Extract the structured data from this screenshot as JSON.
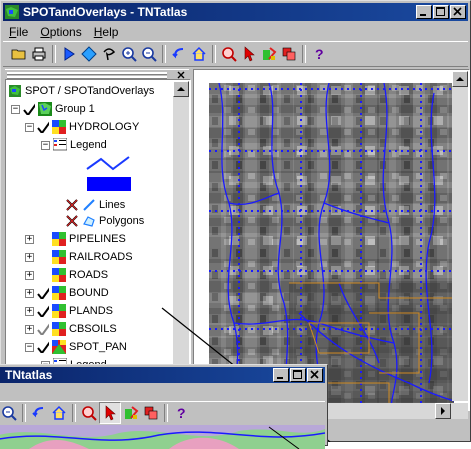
{
  "main_window": {
    "title": "SPOTandOverlays - TNTatlas",
    "menu": [
      "File",
      "Options",
      "Help"
    ],
    "menu_underline": [
      "F",
      "O",
      "H"
    ],
    "menu_rest": [
      "ile",
      "ptions",
      "elp"
    ],
    "toolbar_icons": [
      "open-folder-icon",
      "print-icon",
      "play-icon",
      "diamond-icon",
      "lasso-icon",
      "zoom-in-icon",
      "zoom-out-icon",
      "back-arrow-icon",
      "home-icon",
      "zoom-box-icon",
      "pointer-icon",
      "paint-icon",
      "layers-icon",
      "help-icon"
    ]
  },
  "tree": {
    "root": "SPOT / SPOTandOverlays",
    "group": "Group 1",
    "hydrology": "HYDROLOGY",
    "legend": "Legend",
    "lines": "Lines",
    "polygons": "Polygons",
    "layers": [
      "PIPELINES",
      "RAILROADS",
      "ROADS",
      "BOUND",
      "PLANDS",
      "CBSOILS",
      "SPOT_PAN"
    ],
    "layers_checked": [
      false,
      false,
      false,
      true,
      true,
      true,
      true
    ],
    "legend2": "Legend"
  },
  "second_window": {
    "title": "TNtatlas"
  },
  "colors": {
    "titlebar": "#0a246a",
    "window": "#c0c0c0",
    "water": "#1a1aff",
    "boundary": "#d08a20"
  }
}
